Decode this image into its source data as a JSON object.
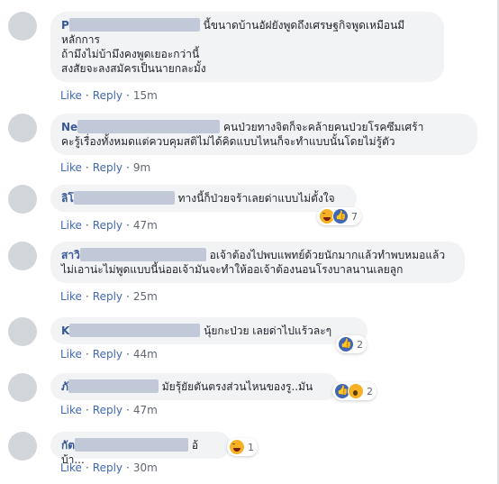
{
  "actions": {
    "like": "Like",
    "reply": "Reply"
  },
  "comments": [
    {
      "name_visible": "P",
      "text": "นี้ขนาดบ้านอัฝยังพูดถึงเศรษฐกิจพูดเหมือนมี\nหลักการ\nถ้ามึงไม่บ้ามึงคงพูดเยอะกว่านี้\nสงสัยจะลงสมัครเป็นนายกละมั้ง",
      "time": "15m"
    },
    {
      "name_visible": "Ne",
      "text": "คนป่วยทางจิตก็จะคล้ายคนป่วยโรคซึมเศร้า\nคะรู้เรื่องทั้งหมดแต่ควบคุมสติไม่ได้คิดแบบไหนก็จะทำแบบนั้นโดยไม่รู้ตัว",
      "time": "9m"
    },
    {
      "name_visible": "ลิโ",
      "text": "ทางนี้ก็ป่วยจร้าเลยด่าแบบไม่ตั้งใจ",
      "time": "47m",
      "reaction_count": "7"
    },
    {
      "name_visible": "สาวิ",
      "text": "อเจ้าต้องไปพบแพทย์ด้วยนักมากแล้วทำพบหมอแล้ว\nไม่เอาน่ะไม่พูดแบบนี้น่ออเจ้ามันจะทำให้ออเจ้าต้องนอนโรงบาลนานเลยลูก",
      "time": "25m"
    },
    {
      "name_visible": "K",
      "text": "นุ้ยกะป่วย เลยด่าไปแร้วละๆ",
      "time": "44m",
      "reaction_count": "2"
    },
    {
      "name_visible": "ภั",
      "text": "มัยรุ้ยัยตันตรงส่วนไหนของรู..มัน",
      "time": "47m",
      "reaction_count": "2"
    },
    {
      "name_visible": "กัต",
      "text": "อ้บ้า...",
      "time": "30m",
      "reaction_count": "1"
    }
  ]
}
